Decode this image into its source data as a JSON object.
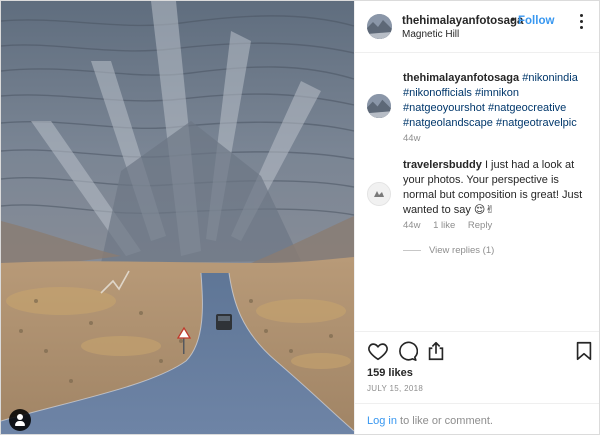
{
  "header": {
    "username": "thehimalayanfotosaga",
    "separator": "•",
    "follow_label": "Follow",
    "location": "Magnetic Hill"
  },
  "caption": {
    "username": "thehimalayanfotosaga",
    "hashtags": [
      "#nikonindia",
      "#nikonofficials",
      "#imnikon",
      "#natgeoyourshot",
      "#natgeocreative",
      "#natgeolandscape",
      "#natgeotravelpic"
    ],
    "time": "44w"
  },
  "comment": {
    "username": "travelersbuddy",
    "text": "I just had a look at your photos. Your perspective is normal but composition is great! Just wanted to say 😌✌",
    "time": "44w",
    "likes": "1 like",
    "reply_label": "Reply",
    "view_replies": "View replies (1)"
  },
  "actions": {
    "likes_count": "159 likes",
    "date": "JULY 15, 2018"
  },
  "login": {
    "link_label": "Log in",
    "rest": " to like or comment."
  },
  "colors": {
    "accent": "#3897f0",
    "hashtag": "#00376b",
    "muted": "#8e8e8e",
    "text": "#262626"
  },
  "icons": {
    "more": "more-options-icon",
    "like": "heart-icon",
    "comment": "comment-bubble-icon",
    "share": "share-icon",
    "save": "bookmark-icon",
    "tag": "user-tag-icon"
  }
}
